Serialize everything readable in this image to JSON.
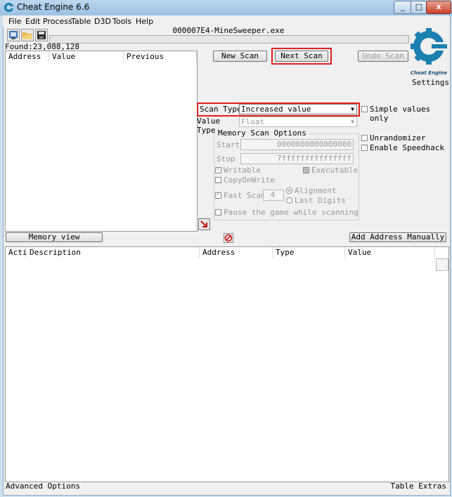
{
  "window": {
    "title": "Cheat Engine 6.6",
    "minimize": "_",
    "maximize": "□",
    "close": "x"
  },
  "menu": [
    "File",
    "Edit",
    "Process",
    "Table",
    "D3D",
    "Tools",
    "Help"
  ],
  "toolbar": {
    "icons": [
      "open-process-icon",
      "open-file-icon",
      "save-icon"
    ]
  },
  "process": "000007E4-MineSweeper.exe",
  "found": {
    "label": "Found:",
    "count": "23,088,128",
    "columns": [
      "Address",
      "Value",
      "Previous"
    ]
  },
  "scan_buttons": {
    "new_scan": "New Scan",
    "next_scan": "Next Scan",
    "undo_scan": "Undo Scan"
  },
  "logo": {
    "text": "Cheat Engine"
  },
  "settings": "Settings",
  "scan_type": {
    "label": "Scan Type",
    "value": "Increased value"
  },
  "value_type": {
    "label": "Value Type",
    "value": "Float"
  },
  "simple_values_only": "Simple values only",
  "memory_scan_options": {
    "title": "Memory Scan Options",
    "start_label": "Start",
    "start_value": "0000000000000000",
    "stop_label": "Stop",
    "stop_value": "7fffffffffffffff",
    "writable": "Writable",
    "executable": "Executable",
    "copyonwrite": "CopyOnWrite",
    "fast_scan": "Fast Scan",
    "fast_scan_value": "4",
    "alignment": "Alignment",
    "last_digits": "Last Digits",
    "pause": "Pause the game while scanning"
  },
  "unrandomizer": "Unrandomizer",
  "enable_speedhack": "Enable Speedhack",
  "memory_view": "Memory view",
  "add_address_manually": "Add Address Manually",
  "address_table": {
    "columns": [
      "Acti",
      "Description",
      "Address",
      "Type",
      "Value"
    ]
  },
  "status": {
    "advanced_options": "Advanced Options",
    "table_extras": "Table Extras"
  },
  "colors": {
    "highlight": "#e02020",
    "logo": "#1b7fb0"
  }
}
